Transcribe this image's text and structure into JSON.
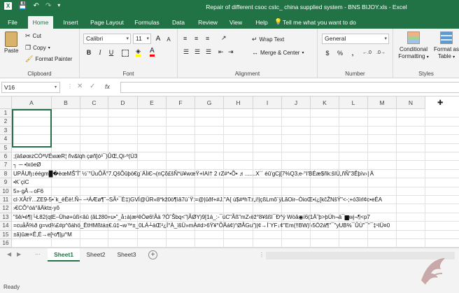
{
  "title_bar": {
    "title": "Repair of different csoc cstc_ china supplied system - BNS BIJOY.xls  -  Excel"
  },
  "tabs": [
    "File",
    "Home",
    "Insert",
    "Page Layout",
    "Formulas",
    "Data",
    "Review",
    "View",
    "Help"
  ],
  "active_tab": "Home",
  "tell_me": "Tell me what you want to do",
  "clipboard": {
    "paste": "Paste",
    "cut": "Cut",
    "copy": "Copy",
    "format_painter": "Format Painter",
    "label": "Clipboard"
  },
  "font": {
    "family": "Calibri",
    "size": "11",
    "bold": "B",
    "italic": "I",
    "underline": "U",
    "grow": "A",
    "shrink": "A",
    "label": "Font"
  },
  "alignment": {
    "wrap_text": "Wrap Text",
    "merge_center": "Merge & Center",
    "label": "Alignment"
  },
  "number": {
    "format": "General",
    "currency": "$",
    "percent": "%",
    "comma": ",",
    "label": "Number"
  },
  "styles": {
    "conditional": "Conditional",
    "formatting": "Formatting",
    "format_as": "Format as",
    "table": "Table",
    "label": "Styles"
  },
  "formula_bar": {
    "name_box": "V16",
    "fx": "fx",
    "content": ""
  },
  "columns": [
    "A",
    "B",
    "C",
    "D",
    "E",
    "F",
    "G",
    "H",
    "I",
    "J",
    "K",
    "L",
    "M",
    "N"
  ],
  "rows": [
    {
      "n": "1",
      "text": ""
    },
    {
      "n": "2",
      "text": ""
    },
    {
      "n": "3",
      "text": ""
    },
    {
      "n": "4",
      "text": ""
    },
    {
      "n": "5",
      "text": ""
    },
    {
      "n": "6",
      "text": ";(àšøœzCÒªVÉwæR¦ ñv&lqh çøñ]ó³¯)ÛŒ,Qi-º(Ù3"
    },
    {
      "n": "7",
      "text": "┐ ─ •lxöeØ"
    },
    {
      "n": "8",
      "text": "UPÂUђ↕éégm█�èœMŠ˜Î˜ ½¨°ÜuÔÃ°7.QšÕûþö€g´ÄÌiЄ¬(nÇõ£šÑ*ü¥wœŸ+IAI† 2     rZ#*•Õ• ♬.......X´´ éû'gCj[7%Q3‚e-°I'BÉæ$ñk:šIÙ„ñÑ\"3Êþìv›∣Ä"
    },
    {
      "n": "9",
      "text": "•K´çiC"
    },
    {
      "n": "10",
      "text": "5»·gÂ→oF6"
    },
    {
      "n": "11",
      "text": "cl·XÂtŸ...ZE9-5•`k_èÈè!.Ñ– –¹ÁÆø¶˜–SÃ¹¯È‡)GVÍ@ÜR«8*kž0ö¶ìâ7ù´Ÿ:=@|ûðf+#J.\"A{ ú$#ªhT:r„i!|çßLmõ¨ÿLãOir–ÒioŒ•í¿[kčŽNšÝ\"<-;+ó3ïrl¢c•eÉA"
    },
    {
      "n": "12",
      "text": "›€CÔ°óá°ãÄkt±-yõ"
    },
    {
      "n": "13",
      "text": "\"šê/•é¶|└Ł82(qtE–Ühø+ûß<âû (âLž80=u•\"_å↕à|æ²êÒø6!Åä    ?Ó˜Šbq<\"|ÃØY)9[1á_:-¯úC\"Ãß\"mZ‹ëž°8¥šßI¯Ð^ÿ     Wòâ◉ï6(1Ä˜þ>þÚh¬ä¯▆wj¬¶<p7"
    },
    {
      "n": "14",
      "text": "=cuåÂ%ð g=vd¾£#p^õáhö_ËtHMßtá±€.û‡¬w™±_0LÁ┴àŒ²¿Í°À_ïšÜ»mÀ#d>6Ÿ¥°ÕÂá¢)°ØÅGu\")|¢→Í¨YF↓¢\"Em(!!BW)'‹5Ö2á¶\"¯\"yUB%¯ÛÙ\"¯\"¯‡¹IÜ¤0"
    },
    {
      "n": "15",
      "text": "±â)ûæ×Ê,É→e[¹o¶|µ^M"
    },
    {
      "n": "16",
      "text": ""
    }
  ],
  "sheets": [
    "Sheet1",
    "Sheet2",
    "Sheet3"
  ],
  "active_sheet": "Sheet1",
  "add_sheet": "+",
  "status": "Ready",
  "colors": {
    "excel_green": "#217346",
    "ribbon_bg": "#f3f3f3",
    "grid_line": "#e2e2e2"
  }
}
